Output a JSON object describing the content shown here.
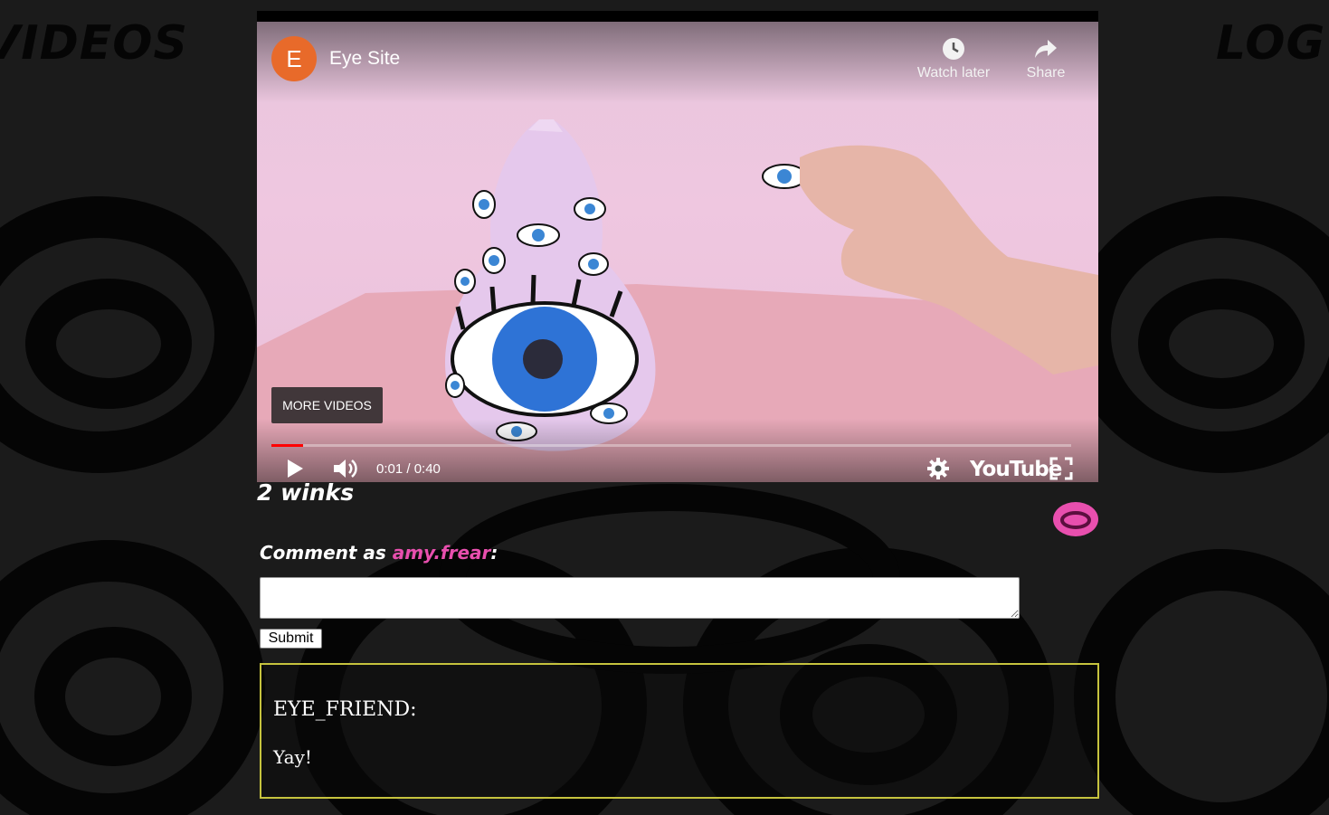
{
  "nav": {
    "left_label": "VIDEOS",
    "right_label": "LOG"
  },
  "video": {
    "channel_initial": "E",
    "title": "Eye Site",
    "watch_later_label": "Watch later",
    "share_label": "Share",
    "more_videos_label": "MORE VIDEOS",
    "time": "0:01 / 0:40",
    "progress_fraction": 0.04,
    "brand_label": "YouTube"
  },
  "winks": {
    "count_label": "2 winks"
  },
  "comment_form": {
    "prefix": "Comment as ",
    "username": "amy.frear",
    "suffix": ":",
    "input_value": "",
    "submit_label": "Submit"
  },
  "comments": [
    {
      "author": "EYE_FRIEND:",
      "text": "Yay!"
    }
  ],
  "colors": {
    "accent_pink": "#e84fae",
    "card_border": "#c6c33e",
    "background": "#1b1b1b"
  }
}
